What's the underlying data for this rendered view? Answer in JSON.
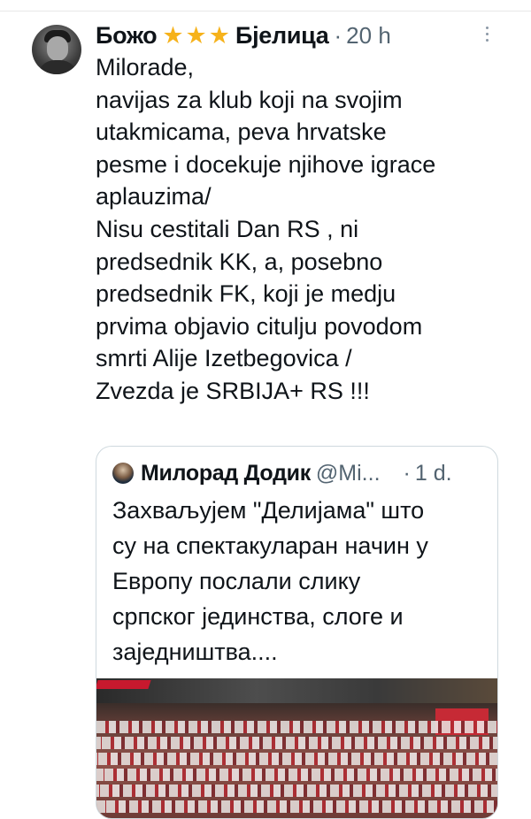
{
  "tweet": {
    "author_name_first": "Божо",
    "author_stars": [
      "★",
      "★",
      "★"
    ],
    "author_name_last": "Бјелица",
    "separator": "·",
    "time": "20 h",
    "lines": [
      "Milorade,",
      "navijas za klub koji na svojim",
      "utakmicama, peva hrvatske",
      "pesme i docekuje njihove igrace",
      "aplauzima/",
      "Nisu cestitali Dan RS , ni",
      "predsednik KK, a, posebno",
      "predsednik FK, koji je medju",
      "prvima objavio citulju povodom",
      "smrti Alije Izetbegovica /",
      "Zvezda je SRBIJA+ RS  !!!"
    ]
  },
  "quoted": {
    "author_name": "Милорад Додик",
    "handle": "@Mi...",
    "separator": "·",
    "time": "1 d.",
    "lines": [
      "Захваљујем \"Делијама\" што",
      "су на спектакуларан начин у",
      "Европу послали слику",
      "српског јединства, слоге и",
      "заједништва...."
    ]
  },
  "colors": {
    "text": "#0f1419",
    "muted": "#536471",
    "star": "#f6b21b",
    "border": "#cfd9de"
  },
  "icons": {
    "more": "more-vertical-icon",
    "star": "star-icon"
  }
}
